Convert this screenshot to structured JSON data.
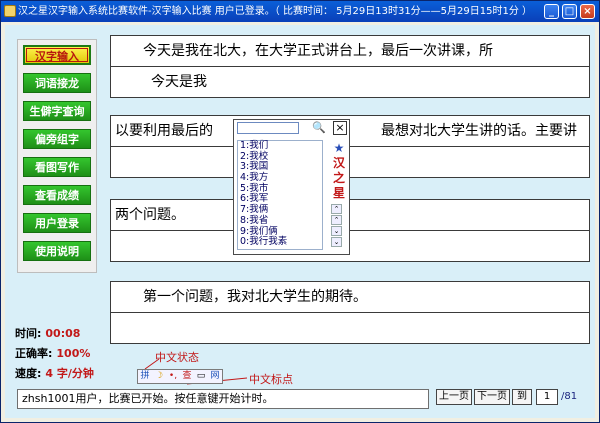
{
  "window": {
    "title": "汉之星汉字输入系统比赛软件-汉字输入比赛  用户已登录。（ 比赛时间：  5月29日13时31分——5月29日15时1分 ）",
    "minimize": "_",
    "maximize": "□",
    "close": "×"
  },
  "sidebar": {
    "items": [
      {
        "label": "汉字输入",
        "active": true
      },
      {
        "label": "词语接龙"
      },
      {
        "label": "生僻字查询"
      },
      {
        "label": "偏旁组字"
      },
      {
        "label": "看图写作"
      },
      {
        "label": "查看成绩"
      },
      {
        "label": "用户登录"
      },
      {
        "label": "使用说明"
      }
    ]
  },
  "lines": [
    {
      "text": "　　今天是我在北大，在大学正式讲台上，最后一次讲课，所",
      "input": "今天是我"
    },
    {
      "text": "以要利用最后的　　　　　　　　　　　　最想对北大学生讲的话。主要讲",
      "input": ""
    },
    {
      "text": "两个问题。",
      "input": ""
    },
    {
      "text": "　　第一个问题，我对北大学生的期待。",
      "input": ""
    }
  ],
  "ime": {
    "search_icon": "🔍",
    "close_label": "×",
    "candidates": [
      "1:我们",
      "2:我校",
      "3:我国",
      "4:我方",
      "5:我市",
      "6:我军",
      "7:我俩",
      "8:我省",
      "9:我们俩",
      "0:我行我素"
    ],
    "logo_text": "汉之星",
    "scroll": [
      "⌃",
      "⌃",
      "⌄",
      "⌄"
    ]
  },
  "stats": {
    "time_label": "时间:",
    "time_value": "00:08",
    "accuracy_label": "正确率:",
    "accuracy_value": "100%",
    "speed_label": "速度:",
    "speed_value": "4 字/分钟"
  },
  "annotations": {
    "cn_state": "中文状态",
    "cn_punct": "中文标点"
  },
  "imebar": [
    "拼",
    "☽",
    "•,",
    "查",
    "▭",
    "网"
  ],
  "status_text": "zhsh1001用户，比赛已开始。按任意键开始计时。",
  "nav": {
    "prev": "上一页",
    "next": "下一页",
    "goto": "到",
    "page": "1",
    "total": "/81"
  },
  "colors": {
    "title_bar": "#0a4fc8",
    "button_green": "#2aa624",
    "active_yellow": "#f5e21a",
    "accent_red": "#c21818",
    "client_bg": "#d9eff8"
  }
}
